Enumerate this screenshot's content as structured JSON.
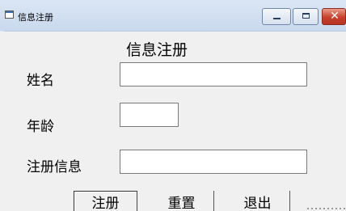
{
  "window": {
    "title": "信息注册",
    "icon": "app-form-icon",
    "controls": {
      "minimize_icon": "minimize-icon",
      "maximize_icon": "maximize-icon",
      "close_icon": "close-icon",
      "close_glyph": "✕"
    }
  },
  "form": {
    "heading": "信息注册",
    "fields": {
      "name": {
        "label": "姓名",
        "value": "",
        "placeholder": ""
      },
      "age": {
        "label": "年龄",
        "value": "",
        "placeholder": ""
      },
      "info": {
        "label": "注册信息",
        "value": "",
        "placeholder": ""
      }
    },
    "buttons": {
      "register": "注册",
      "reset": "重置",
      "exit": "退出"
    }
  },
  "colors": {
    "titlebar": "#c9d9ee",
    "close_button": "#c6412d",
    "client_background": "#f0f0f0"
  }
}
